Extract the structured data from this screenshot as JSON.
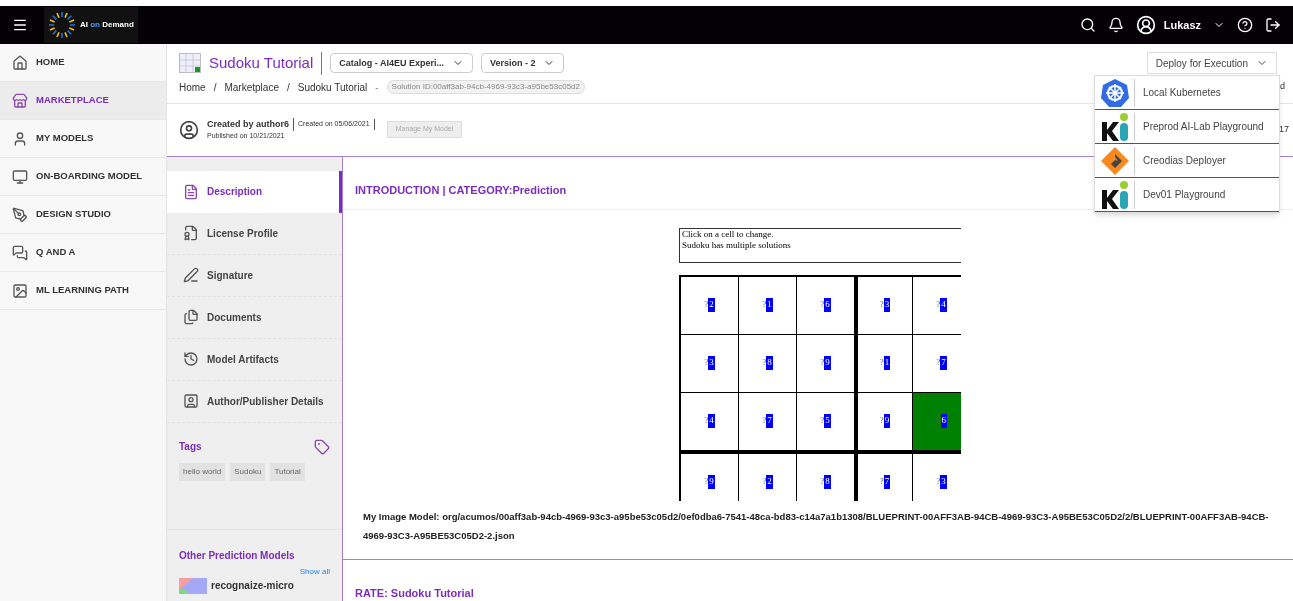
{
  "topbar": {
    "logo": {
      "ai": "AI",
      "on": "on",
      "demand": "Demand"
    },
    "user": "Lukasz"
  },
  "sidebar": {
    "items": [
      {
        "label": "HOME",
        "selected": false
      },
      {
        "label": "MARKETPLACE",
        "selected": true
      },
      {
        "label": "MY MODELS",
        "selected": false
      },
      {
        "label": "ON-BOARDING MODEL",
        "selected": false
      },
      {
        "label": "DESIGN STUDIO",
        "selected": false
      },
      {
        "label": "Q AND A",
        "selected": false
      },
      {
        "label": "ML LEARNING PATH",
        "selected": false
      }
    ]
  },
  "header": {
    "title": "Sudoku Tutorial",
    "catalog": "Catalog - AI4EU Experi...",
    "version": "Version - 2",
    "breadcrumb": [
      "Home",
      "Marketplace",
      "Sudoku Tutorial"
    ],
    "breadcrumb_separator": "/",
    "id_dash": "-",
    "solution_id": "Solution ID:00aff3ab-94cb-4969-93c3-a95be53c05d2",
    "created_by": "Created by author6",
    "created_on": "Created on 05/06/2021",
    "published_on": "Published on 10/21/2021",
    "manage_button": {
      "label": "Manage My Model",
      "disabled": true
    },
    "deploy_button": "Deploy for Execution",
    "peek_texts": [
      "d",
      "17"
    ]
  },
  "deploy_menu": [
    {
      "label": "Local Kubernetes",
      "kind": "wheel"
    },
    {
      "label": "Preprod AI-Lab Playground",
      "kind": "ki"
    },
    {
      "label": "Creodias Deployer",
      "kind": "diamond"
    },
    {
      "label": "Dev01 Playground",
      "kind": "ki"
    }
  ],
  "tabs": [
    {
      "label": "Description",
      "selected": true
    },
    {
      "label": "License Profile",
      "selected": false
    },
    {
      "label": "Signature",
      "selected": false
    },
    {
      "label": "Documents",
      "selected": false
    },
    {
      "label": "Model Artifacts",
      "selected": false
    },
    {
      "label": "Author/Publisher Details",
      "selected": false
    }
  ],
  "tags": {
    "title": "Tags",
    "items": [
      "hello world",
      "Sudoku",
      "Tutorial"
    ]
  },
  "other_models": {
    "title": "Other Prediction Models",
    "show_all": "Show all",
    "items": [
      "recognaize-micro"
    ]
  },
  "content": {
    "heading": "INTRODUCTION | CATEGORY:Prediction",
    "instructions": [
      "Click on a cell to change.",
      "Sudoku has multiple solutions"
    ],
    "grid": [
      [
        {
          "prefix": "?",
          "value": "2",
          "selected": false
        },
        {
          "prefix": "?",
          "value": "1",
          "selected": false
        },
        {
          "prefix": "?",
          "value": "6",
          "selected": false
        },
        {
          "prefix": "?",
          "value": "3",
          "selected": false
        },
        {
          "prefix": "?",
          "value": "4",
          "selected": false
        }
      ],
      [
        {
          "prefix": "?",
          "value": "3",
          "selected": false
        },
        {
          "prefix": "?",
          "value": "8",
          "selected": false
        },
        {
          "prefix": "?",
          "value": "9",
          "selected": false
        },
        {
          "prefix": "?",
          "value": "1",
          "selected": false
        },
        {
          "prefix": "?",
          "value": "7",
          "selected": false
        }
      ],
      [
        {
          "prefix": "?",
          "value": "4",
          "selected": false
        },
        {
          "prefix": "?",
          "value": "7",
          "selected": false
        },
        {
          "prefix": "?",
          "value": "5",
          "selected": false
        },
        {
          "prefix": "?",
          "value": "9",
          "selected": false
        },
        {
          "prefix": "6",
          "value": "6",
          "selected": true
        }
      ],
      [
        {
          "prefix": "?",
          "value": "9",
          "selected": false
        },
        {
          "prefix": "?",
          "value": "2",
          "selected": false
        },
        {
          "prefix": "?",
          "value": "8",
          "selected": false
        },
        {
          "prefix": "?",
          "value": "7",
          "selected": false
        },
        {
          "prefix": "?",
          "value": "3",
          "selected": false
        }
      ]
    ],
    "image_model": "My Image Model: org/acumos/00aff3ab-94cb-4969-93c3-a95be53c05d2/0ef0dba6-7541-48ca-bd83-c14a7a1b1308/BLUEPRINT-00AFF3AB-94CB-4969-93C3-A95BE53C05D2/2/BLUEPRINT-00AFF3AB-94CB-4969-93C3-A95BE53C05D2-2.json",
    "rate_heading": "RATE: Sudoku Tutorial"
  }
}
